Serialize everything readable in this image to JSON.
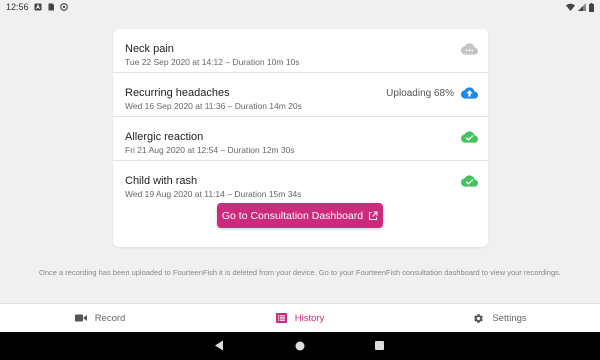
{
  "status_bar": {
    "time": "12:56",
    "left_icons": [
      "notification-a-icon",
      "sim-card-icon",
      "sync-icon"
    ],
    "right_icons": [
      "wifi-icon",
      "signal-icon",
      "battery-icon"
    ]
  },
  "recordings": [
    {
      "title": "Neck pain",
      "meta": "Tue 22 Sep 2020 at 14:12 – Duration 10m 10s",
      "status": "",
      "icon": "cloud-pending-icon"
    },
    {
      "title": "Recurring headaches",
      "meta": "Wed 16 Sep 2020 at 11:36 – Duration 14m 20s",
      "status": "Uploading 68%",
      "progress": 0.68,
      "icon": "cloud-upload-icon"
    },
    {
      "title": "Allergic reaction",
      "meta": "Fri 21 Aug 2020 at 12:54 – Duration 12m 30s",
      "status": "",
      "icon": "cloud-done-icon"
    },
    {
      "title": "Child with rash",
      "meta": "Wed 19 Aug 2020 at 11:14 – Duration 15m 34s",
      "status": "",
      "icon": "cloud-done-icon"
    }
  ],
  "dashboard_button": {
    "label": "Go to Consultation Dashboard",
    "icon": "external-link-icon"
  },
  "info_text": "Once a recording has been uploaded to FourteenFish it is deleted from your device. Go to your FourteenFish consultation dashboard to view your recordings.",
  "tabs": [
    {
      "label": "Record",
      "icon": "video-camera-icon",
      "active": false
    },
    {
      "label": "History",
      "icon": "history-list-icon",
      "active": true
    },
    {
      "label": "Settings",
      "icon": "gear-icon",
      "active": false
    }
  ],
  "colors": {
    "accent": "#cc2a7c",
    "upload_blue": "#1e88e5",
    "done_green": "#43c35e",
    "pending_grey": "#c4c4c4"
  }
}
